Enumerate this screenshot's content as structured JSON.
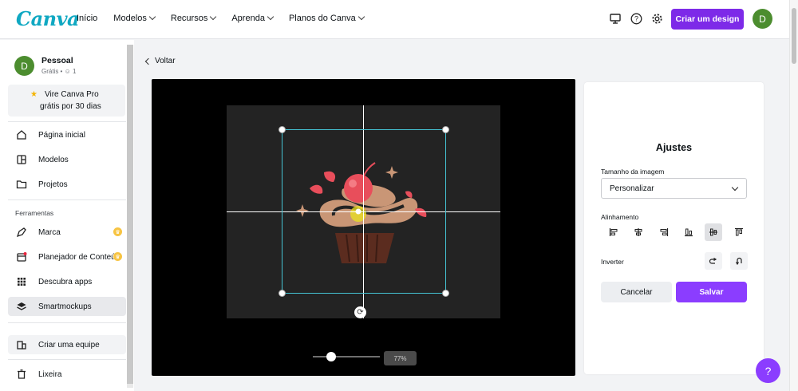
{
  "app": {
    "logo": "Canva"
  },
  "header": {
    "nav": [
      {
        "label": "Início",
        "dropdown": false
      },
      {
        "label": "Modelos",
        "dropdown": true
      },
      {
        "label": "Recursos",
        "dropdown": true
      },
      {
        "label": "Aprenda",
        "dropdown": true
      },
      {
        "label": "Planos do Canva",
        "dropdown": true
      }
    ],
    "cta_label": "Criar um design",
    "avatar_initial": "D",
    "icons": [
      "desktop-icon",
      "help-circle-icon",
      "gear-icon"
    ]
  },
  "sidebar": {
    "account_initial": "D",
    "account_name": "Pessoal",
    "account_sub": "Grátis • ☺ 1",
    "pro_line1": "Vire Canva Pro",
    "pro_line2": "grátis por 30 dias",
    "main_items": [
      {
        "label": "Página inicial",
        "icon": "home-icon"
      },
      {
        "label": "Modelos",
        "icon": "templates-icon"
      },
      {
        "label": "Projetos",
        "icon": "folder-icon"
      }
    ],
    "tools_heading": "Ferramentas",
    "tool_items": [
      {
        "label": "Marca",
        "icon": "brand-icon",
        "badge": "crown"
      },
      {
        "label": "Planejador de Conteúd",
        "icon": "calendar-icon",
        "badge": "crown"
      },
      {
        "label": "Descubra apps",
        "icon": "apps-grid-icon"
      },
      {
        "label": "Smartmockups",
        "icon": "layers-icon",
        "active": true
      }
    ],
    "team_item": "Criar uma equipe",
    "trash_item": "Lixeira"
  },
  "main": {
    "back_label": "Voltar",
    "zoom_value": "77%",
    "zoom_level": 0.27
  },
  "panel": {
    "title": "Ajustes",
    "size_label": "Tamanho da imagem",
    "size_value": "Personalizar",
    "align_label": "Alinhamento",
    "align_options": [
      "align-left",
      "align-center-horizontal",
      "align-right",
      "align-bottom",
      "align-middle",
      "align-top"
    ],
    "align_selected": "align-middle",
    "invert_label": "Inverter",
    "cancel_label": "Cancelar",
    "save_label": "Salvar"
  },
  "help_label": "?",
  "colors": {
    "accent": "#8b3dff",
    "brand": "#10a8c2",
    "crop": "#45c3d3"
  }
}
